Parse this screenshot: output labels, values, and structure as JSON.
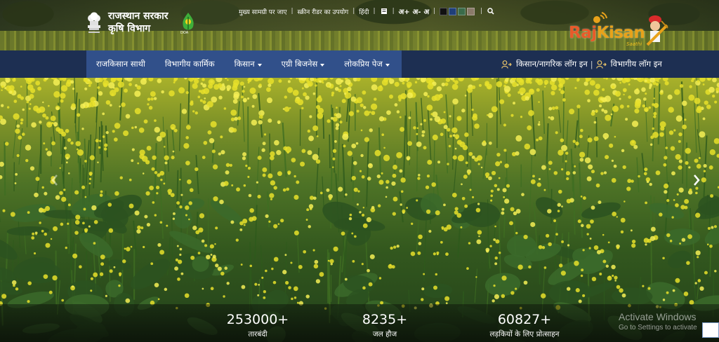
{
  "header": {
    "title_line1": "राजस्थान सरकार",
    "title_line2": "कृषि विभाग",
    "doa_tag": "DOA",
    "utility": {
      "skip_to_content": "मुख्य सामग्री पर जाए",
      "screen_reader": "स्क्रीन रीडर का उपयोग",
      "language": "हिंदी",
      "font_increase": "अ+",
      "font_decrease": "अ-",
      "font_normal": "अ",
      "theme_colors": [
        "#111111",
        "#1f3f7a",
        "#3a6b4a",
        "#8a7a6a"
      ]
    },
    "brand": {
      "name_part1": "Raj",
      "name_part2": "Kisan",
      "tagline": "Saathi"
    }
  },
  "nav": {
    "items": [
      {
        "label": "राजकिसान साथी",
        "dropdown": false
      },
      {
        "label": "विभागीय कार्मिक",
        "dropdown": false
      },
      {
        "label": "किसान",
        "dropdown": true
      },
      {
        "label": "एग्री बिजनेस",
        "dropdown": true
      },
      {
        "label": "लोकप्रिय पेज",
        "dropdown": true
      }
    ],
    "citizen_login": "किसान/नागरिक लॉग इन",
    "dept_login": "विभागीय लॉग इन",
    "login_separator": "|"
  },
  "stats": [
    {
      "value": "253000+",
      "label": "तारबंदी"
    },
    {
      "value": "8235+",
      "label": "जल हौज"
    },
    {
      "value": "60827+",
      "label": "लड़कियों के लिए प्रोत्साहन"
    }
  ],
  "watermark": {
    "line1": "Activate Windows",
    "line2": "Go to Settings to activate"
  }
}
